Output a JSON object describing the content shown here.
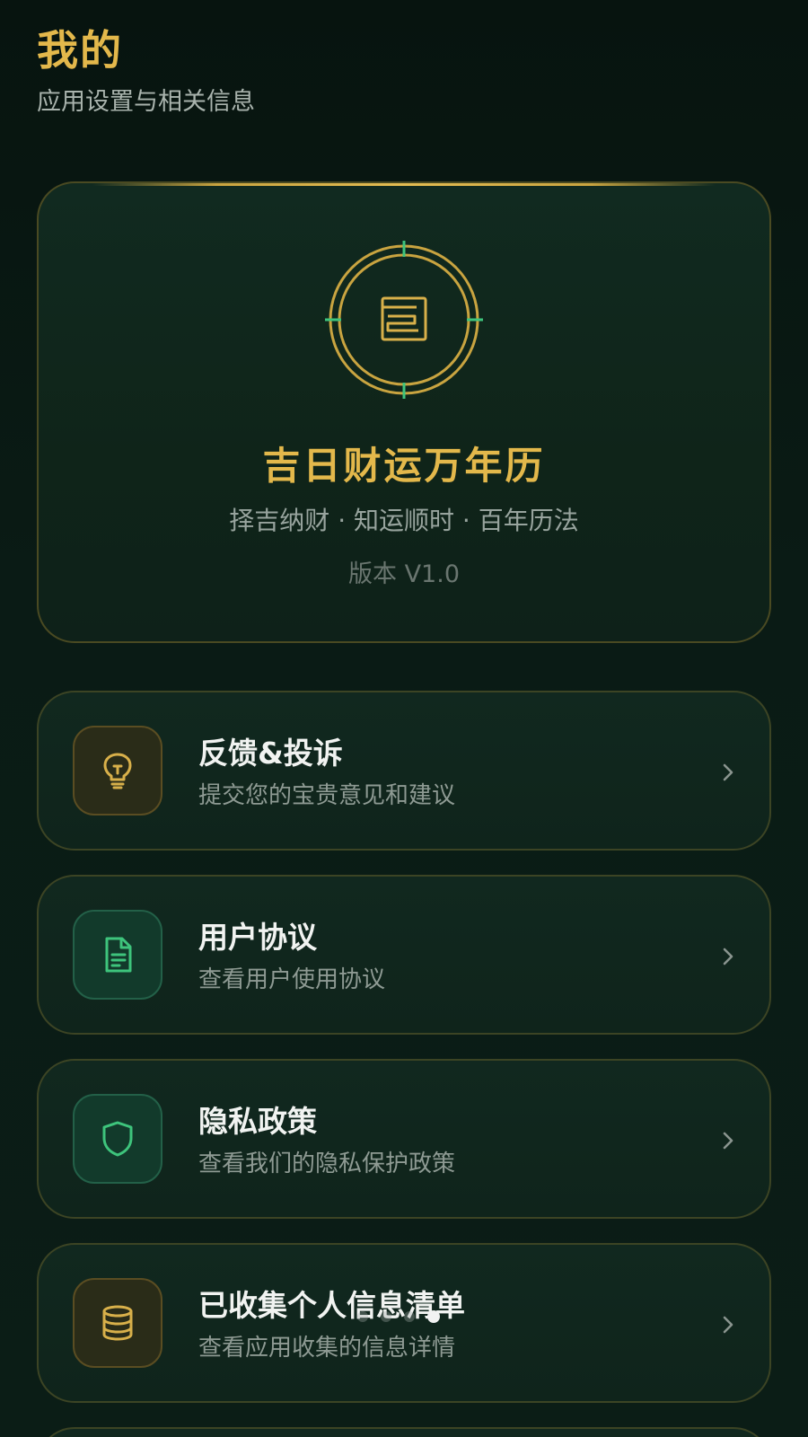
{
  "header": {
    "title": "我的",
    "subtitle": "应用设置与相关信息"
  },
  "app_card": {
    "emblem_icon": "calendar-seal-icon",
    "name": "吉日财运万年历",
    "slogan": "择吉纳财 · 知运顺时 · 百年历法",
    "version": "版本 V1.0"
  },
  "menu": {
    "items": [
      {
        "title": "反馈&投诉",
        "desc": "提交您的宝贵意见和建议",
        "icon": "lightbulb-icon",
        "tone": "gold"
      },
      {
        "title": "用户协议",
        "desc": "查看用户使用协议",
        "icon": "document-icon",
        "tone": "green"
      },
      {
        "title": "隐私政策",
        "desc": "查看我们的隐私保护政策",
        "icon": "shield-icon",
        "tone": "green"
      },
      {
        "title": "已收集个人信息清单",
        "desc": "查看应用收集的信息详情",
        "icon": "database-icon",
        "tone": "gold"
      }
    ]
  },
  "pager": {
    "count": 4,
    "active_index": 3
  },
  "colors": {
    "background": "#08160f",
    "gold": "#e3b84b",
    "green": "#2fbf7a",
    "card": "#10261d"
  }
}
